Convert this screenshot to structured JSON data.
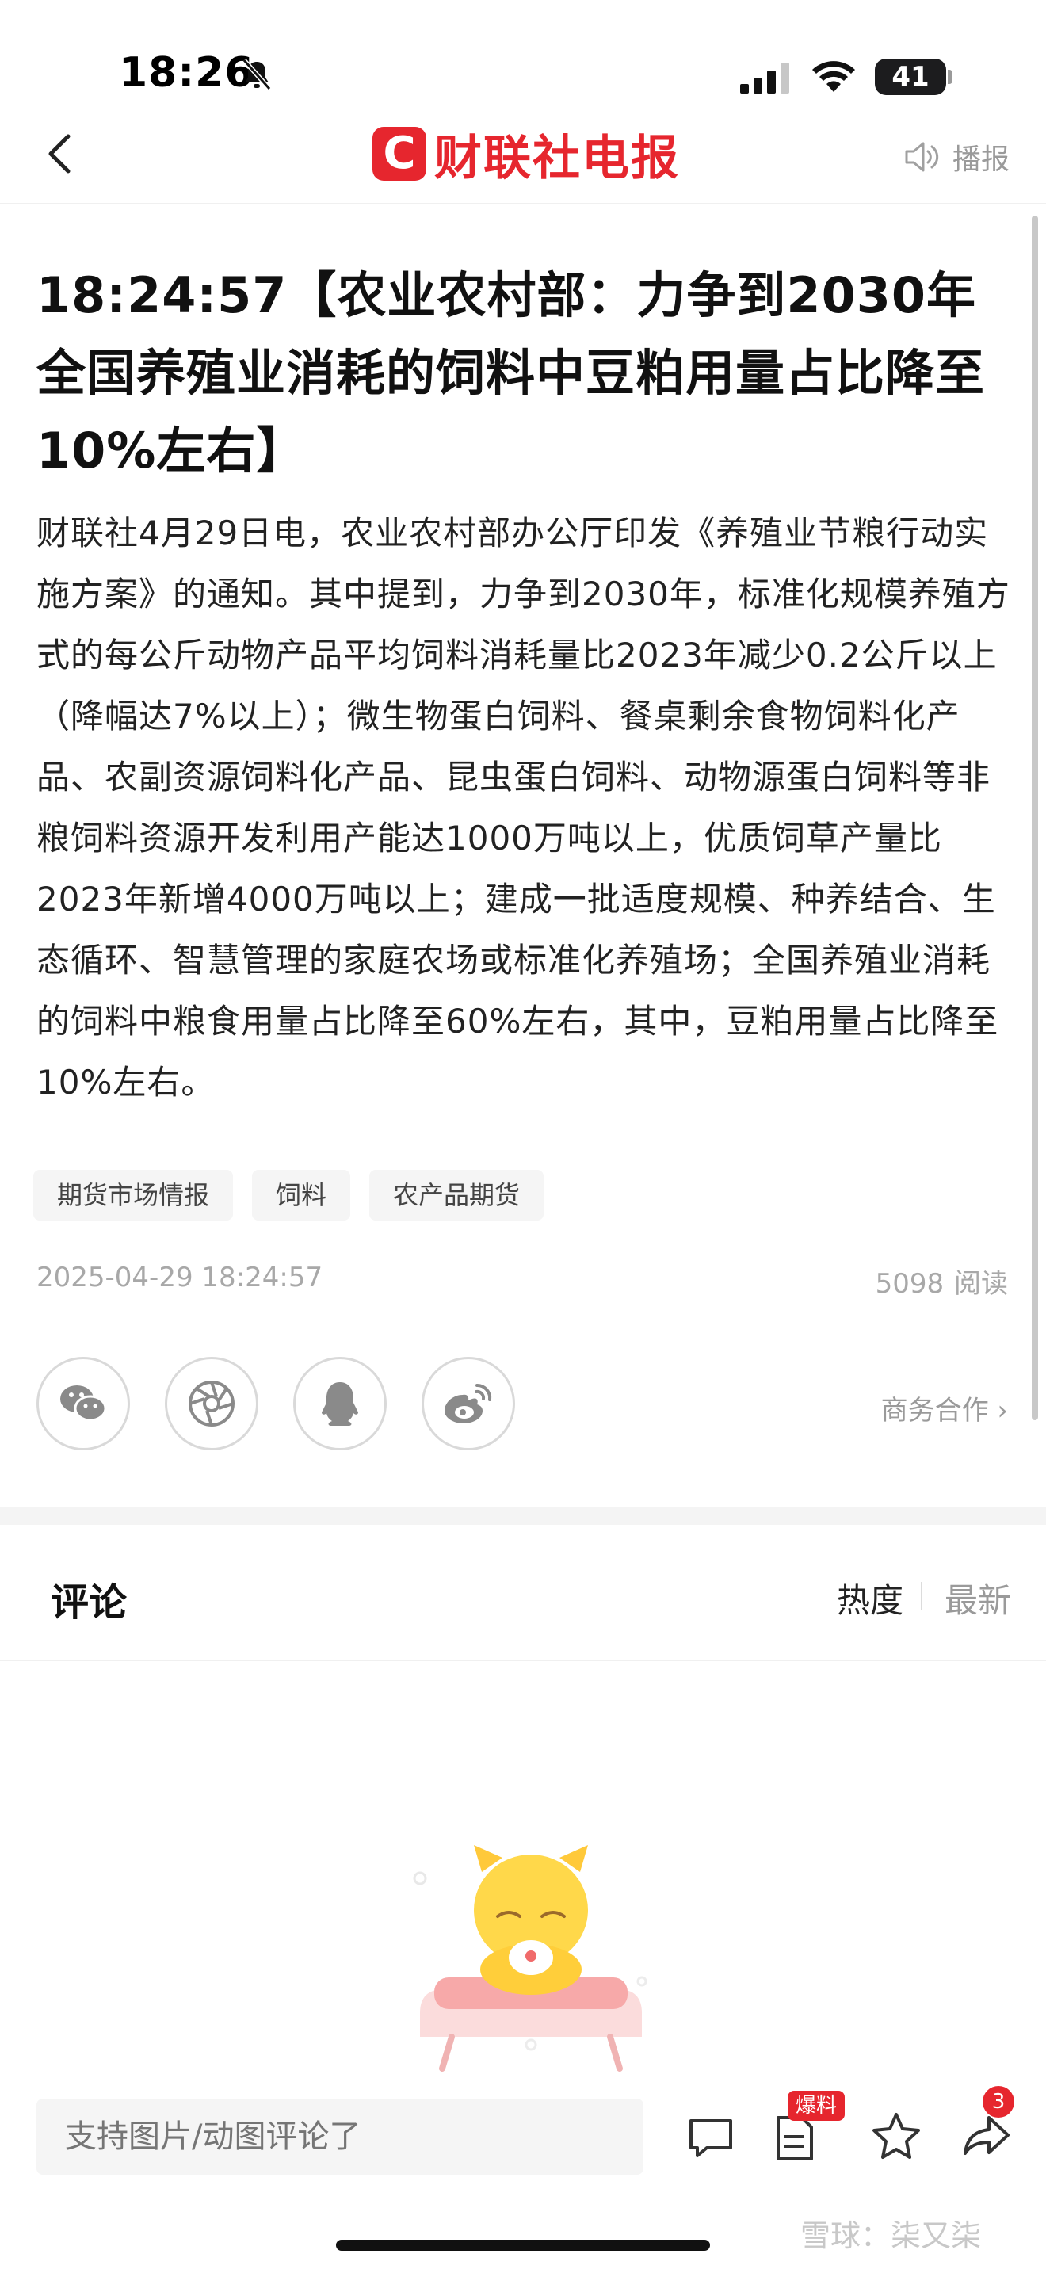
{
  "status_bar": {
    "time": "18:26",
    "battery": "41"
  },
  "nav": {
    "brand_logo": "C",
    "brand_name": "财联社电报",
    "broadcast_label": "播报",
    "brand_color": "#e6262e"
  },
  "article": {
    "headline": "18:24:57【农业农村部：力争到2030年全国养殖业消耗的饲料中豆粕用量占比降至10%左右】",
    "body": "财联社4月29日电，农业农村部办公厅印发《养殖业节粮行动实施方案》的通知。其中提到，力争到2030年，标准化规模养殖方式的每公斤动物产品平均饲料消耗量比2023年减少0.2公斤以上（降幅达7%以上）；微生物蛋白饲料、餐桌剩余食物饲料化产品、农副资源饲料化产品、昆虫蛋白饲料、动物源蛋白饲料等非粮饲料资源开发利用产能达1000万吨以上，优质饲草产量比2023年新增4000万吨以上；建成一批适度规模、种养结合、生态循环、智慧管理的家庭农场或标准化养殖场；全国养殖业消耗的饲料中粮食用量占比降至60%左右，其中，豆粕用量占比降至10%左右。",
    "tags": [
      "期货市场情报",
      "饲料",
      "农产品期货"
    ],
    "publish_time": "2025-04-29 18:24:57",
    "read_count": "5098",
    "read_label": "阅读"
  },
  "share": {
    "icons": [
      "wechat-icon",
      "moments-icon",
      "qq-icon",
      "weibo-icon"
    ],
    "business_link": "商务合作 ›"
  },
  "comments": {
    "title": "评论",
    "sort_hot": "热度",
    "sort_new": "最新"
  },
  "bottom_bar": {
    "input_placeholder": "支持图片/动图评论了",
    "report_badge": "爆料",
    "share_count": "3"
  },
  "watermark": "雪球：柒又柒"
}
